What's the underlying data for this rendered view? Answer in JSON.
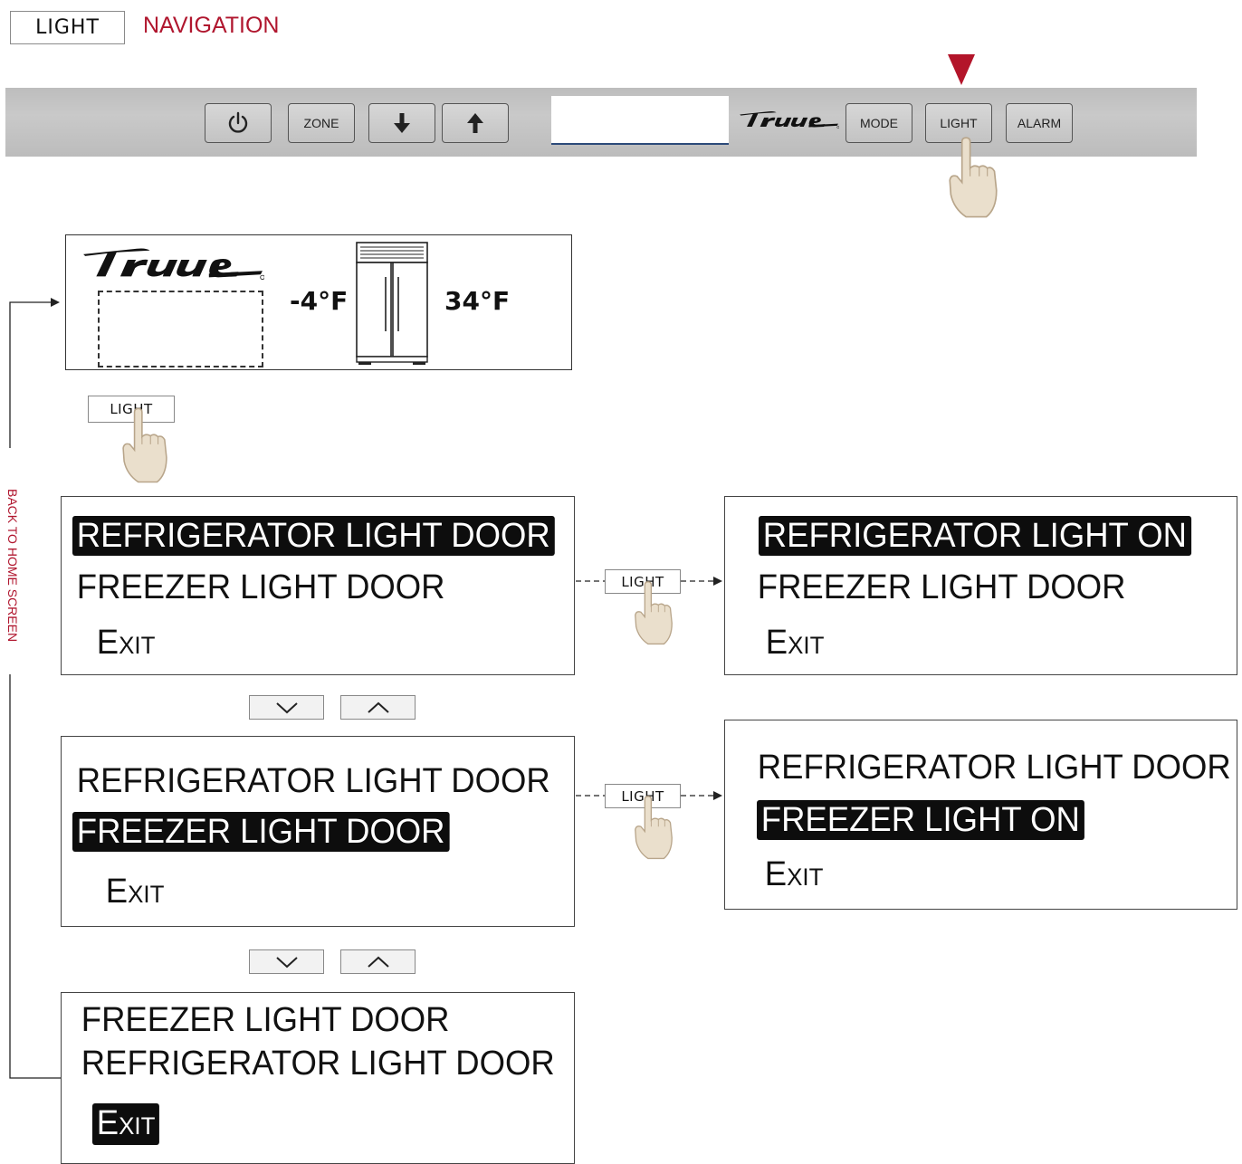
{
  "header": {
    "badge": "LIGHT",
    "title": "NAVIGATION"
  },
  "control_bar": {
    "buttons": {
      "zone": "ZONE",
      "mode": "MODE",
      "light": "LIGHT",
      "alarm": "ALARM"
    }
  },
  "home_screen": {
    "freezer_temp": "-4°F",
    "fridge_temp": "34°F"
  },
  "light_key": "LIGHT",
  "screens": [
    {
      "lines": [
        "REFRIGERATOR LIGHT DOOR",
        "FREEZER LIGHT DOOR"
      ],
      "exit": "Exit",
      "selected": 0
    },
    {
      "lines": [
        "REFRIGERATOR LIGHT DOOR",
        "FREEZER LIGHT DOOR"
      ],
      "exit": "Exit",
      "selected": 1
    },
    {
      "lines": [
        "FREEZER LIGHT DOOR",
        "REFRIGERATOR LIGHT DOOR"
      ],
      "exit": "Exit",
      "selected": 2
    },
    {
      "lines": [
        "REFRIGERATOR LIGHT ON",
        "FREEZER LIGHT DOOR"
      ],
      "exit": "Exit",
      "selected": 0
    },
    {
      "lines": [
        "REFRIGERATOR LIGHT DOOR",
        "FREEZER LIGHT ON"
      ],
      "exit": "Exit",
      "selected": 1
    }
  ],
  "back_to_home": "BACK TO HOME SCREEN",
  "colors": {
    "accent_red": "#b0162e",
    "highlight": "#0d0d0d",
    "finger": "#eadfcc"
  }
}
